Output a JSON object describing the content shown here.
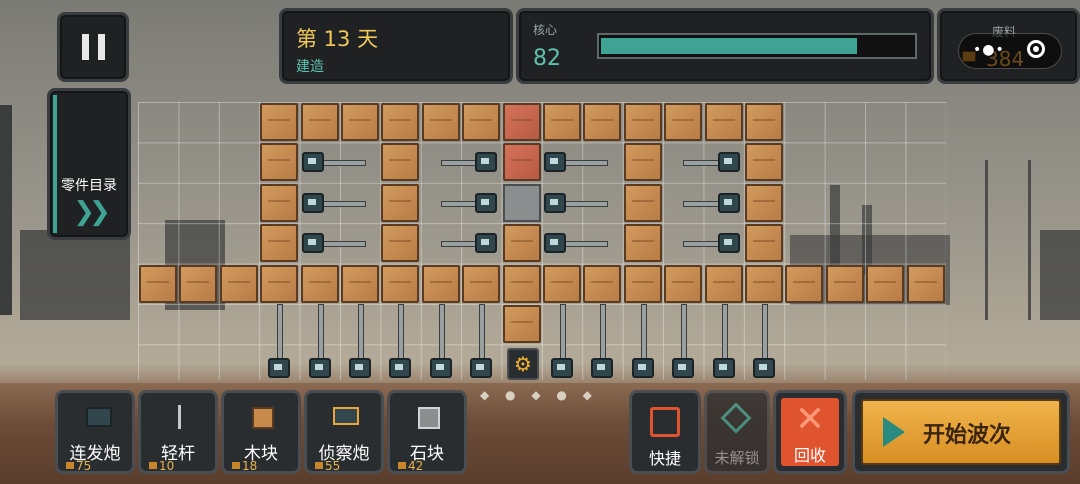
{
  "header": {
    "day_label": "第 13 天",
    "phase": "建造",
    "core_label": "核心",
    "core_value": "82",
    "core_ratio": 0.82,
    "scrap_label": "废料",
    "scrap_value": "384"
  },
  "sidebar": {
    "catalog_label": "零件目录"
  },
  "parts": [
    {
      "label": "连发炮",
      "cost": "75"
    },
    {
      "label": "轻杆",
      "cost": "10"
    },
    {
      "label": "木块",
      "cost": "18"
    },
    {
      "label": "侦察炮",
      "cost": "55"
    },
    {
      "label": "石块",
      "cost": "42"
    }
  ],
  "actions": {
    "quick_label": "快捷",
    "unlock_label": "未解锁",
    "recycle_label": "回收",
    "start_wave_label": "开始波次"
  },
  "colors": {
    "accent_teal": "#3fa394",
    "gold": "#e8a63a",
    "recycle_red": "#e0532f"
  }
}
